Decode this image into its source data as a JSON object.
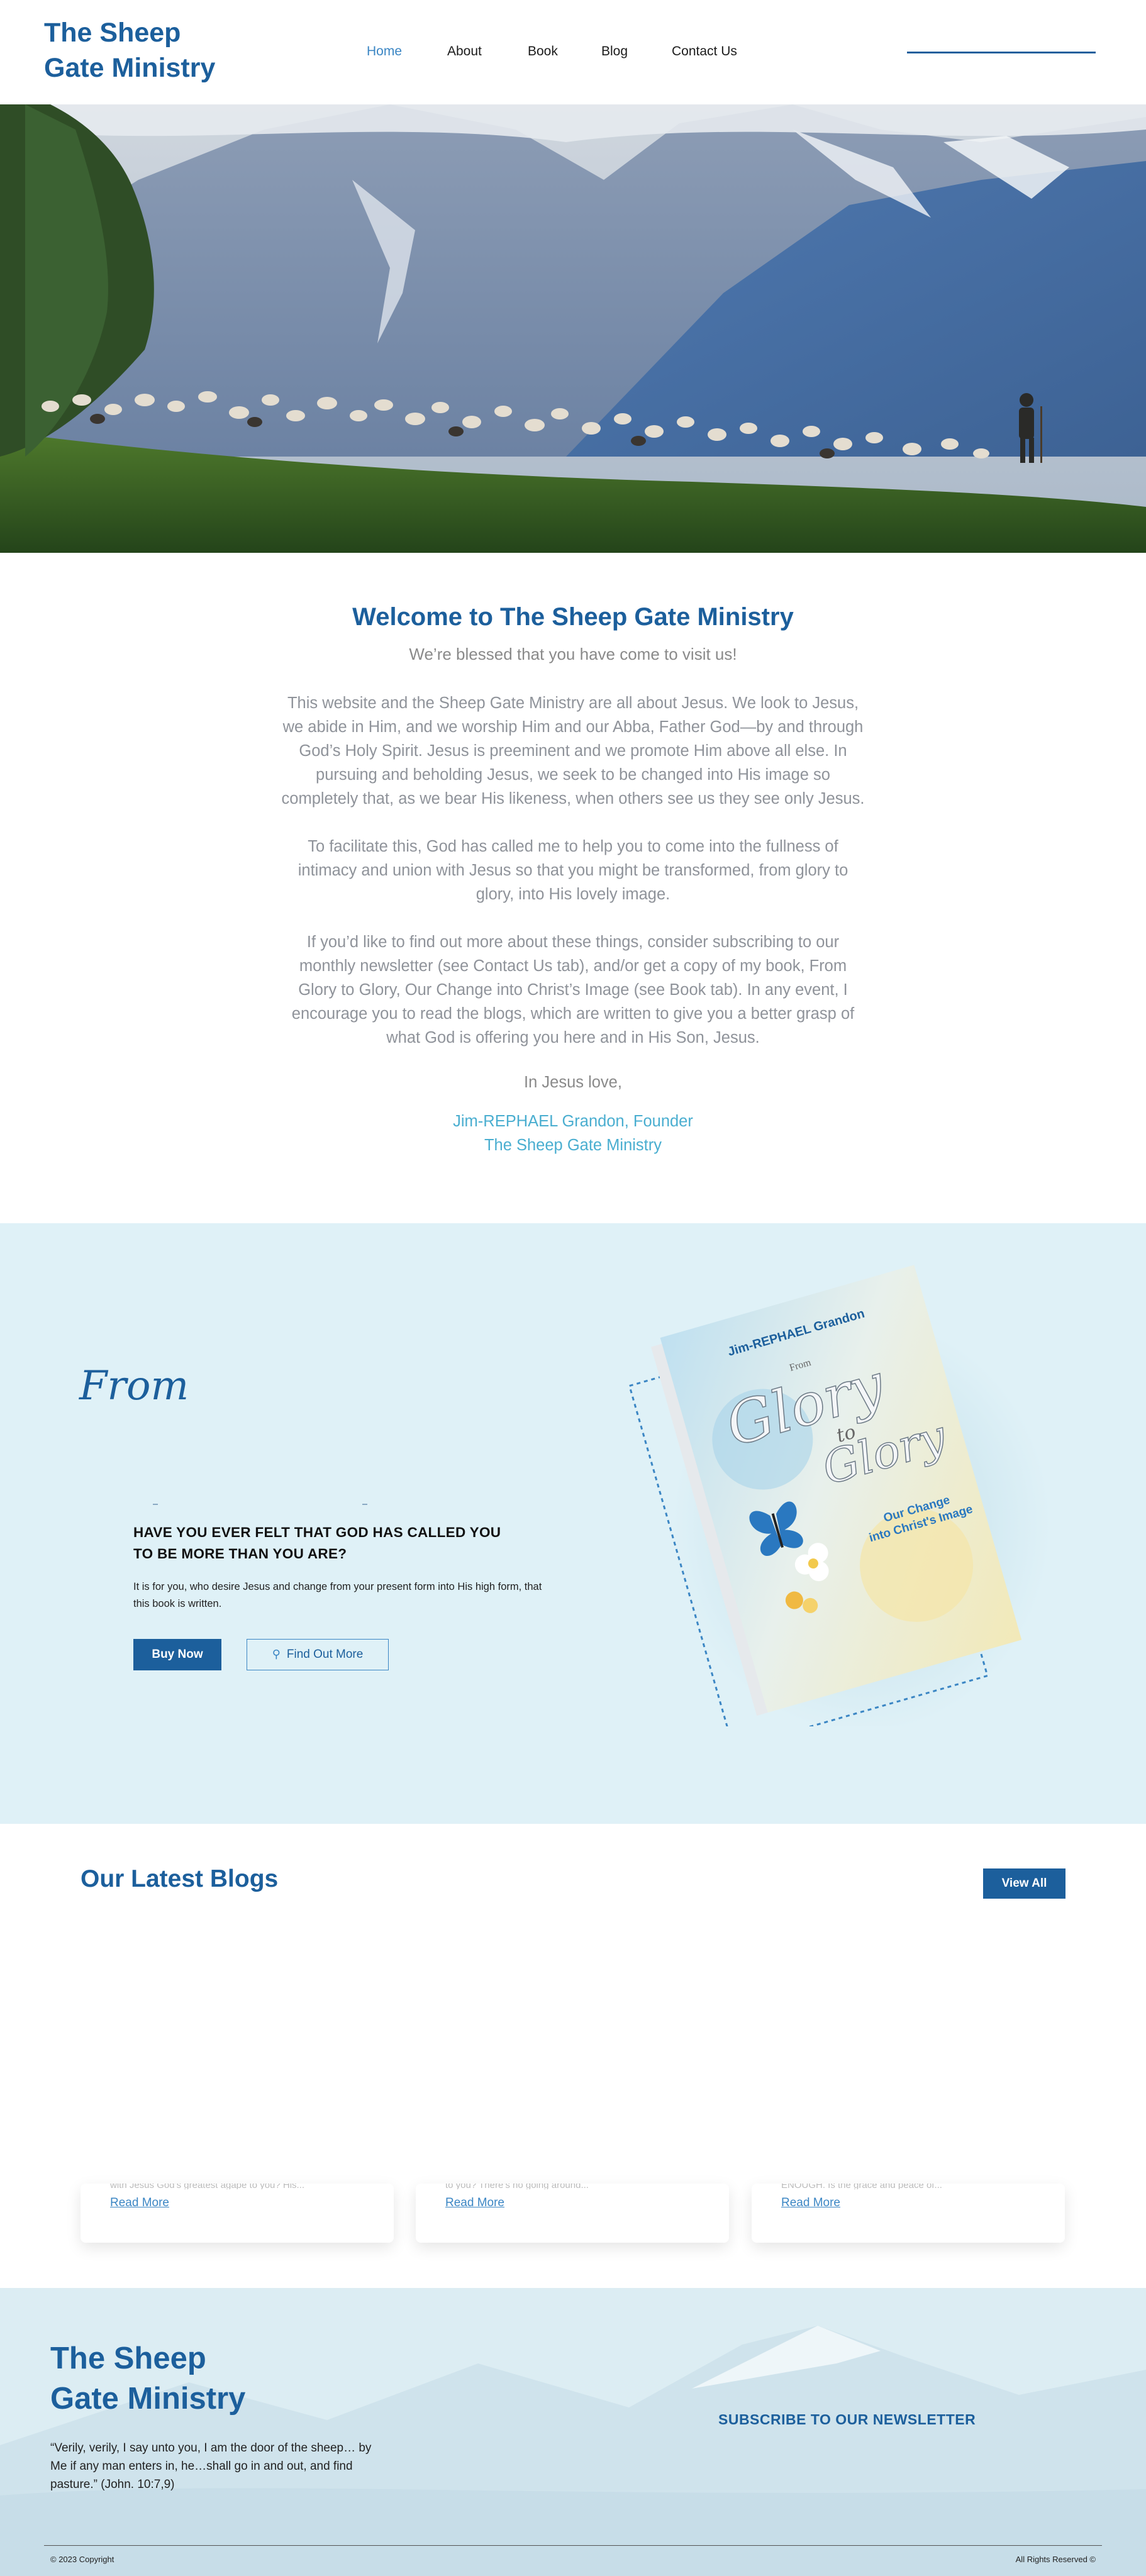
{
  "header": {
    "logo_line1": "The Sheep",
    "logo_line2": "Gate Ministry",
    "nav": [
      {
        "label": "Home"
      },
      {
        "label": "About"
      },
      {
        "label": "Book"
      },
      {
        "label": "Blog"
      },
      {
        "label": "Contact Us"
      }
    ],
    "active_nav": "Home"
  },
  "welcome": {
    "title": "Welcome to The Sheep Gate Ministry",
    "subtitle": "We’re blessed that you have come to visit us!",
    "paragraphs": [
      "This website and the Sheep Gate Ministry are all about Jesus. We look to Jesus, we abide in Him, and we worship Him and our Abba, Father God—by and through God’s Holy Spirit. Jesus is preeminent and we promote Him above all else. In pursuing and beholding Jesus, we seek to be changed into His image so completely that, as we bear His likeness, when others see us they see only Jesus.",
      "To facilitate this, God has called me to help you to come into the fullness of intimacy and union with Jesus so that you might be transformed, from glory to glory, into His lovely image.",
      "If you’d like to find out more about these things, consider subscribing to our monthly newsletter (see Contact Us tab), and/or get a copy of my book, From Glory to Glory, Our Change into Christ’s Image (see Book tab). In any event, I encourage you to read the blogs, which are written to give you a better grasp of what God is offering you here and in His Son, Jesus."
    ],
    "closing": "In Jesus love,",
    "signature_name": "Jim-REPHAEL Grandon, Founder",
    "signature_org": "The Sheep Gate Ministry"
  },
  "book_section": {
    "script_word": "From",
    "heading": "HAVE YOU EVER FELT THAT GOD HAS CALLED YOU TO BE MORE THAN YOU ARE?",
    "body": "It is for you, who desire Jesus and change from your present form into His high form, that this book is written.",
    "buy_label": "Buy Now",
    "more_label": "Find Out More",
    "more_icon": "search-icon",
    "book": {
      "author": "Jim-REPHAEL Grandon",
      "from_word": "From",
      "glory1": "Glory",
      "to_word": "to",
      "glory2": "Glory",
      "subtitle_line1": "Our Change",
      "subtitle_line2": "into Christ's Image"
    }
  },
  "blogs": {
    "title": "Our Latest Blogs",
    "view_all_label": "View All",
    "cards": [
      {
        "snippet": "with Jesus God’s greatest agape to you? His...",
        "read_more": "Read More"
      },
      {
        "snippet": "to you? There’s no going around...",
        "read_more": "Read More"
      },
      {
        "snippet": "ENOUGH. Is the grace and peace of...",
        "read_more": "Read More"
      }
    ]
  },
  "footer": {
    "logo_line1": "The Sheep",
    "logo_line2": "Gate Ministry",
    "quote": "“Verily, verily, I say unto you, I am the door of the sheep… by Me if any man enters in, he…shall go in and out, and find pasture.” (John. 10:7,9)",
    "newsletter": "SUBSCRIBE TO OUR NEWSLETTER",
    "copyright": "© 2023 Copyright",
    "rights": "All Rights Reserved ©"
  },
  "colors": {
    "brand_blue": "#1c5f9c",
    "link_blue": "#3b86c4",
    "signature_teal": "#4aaed0",
    "book_section_bg": "#dff1f7"
  }
}
